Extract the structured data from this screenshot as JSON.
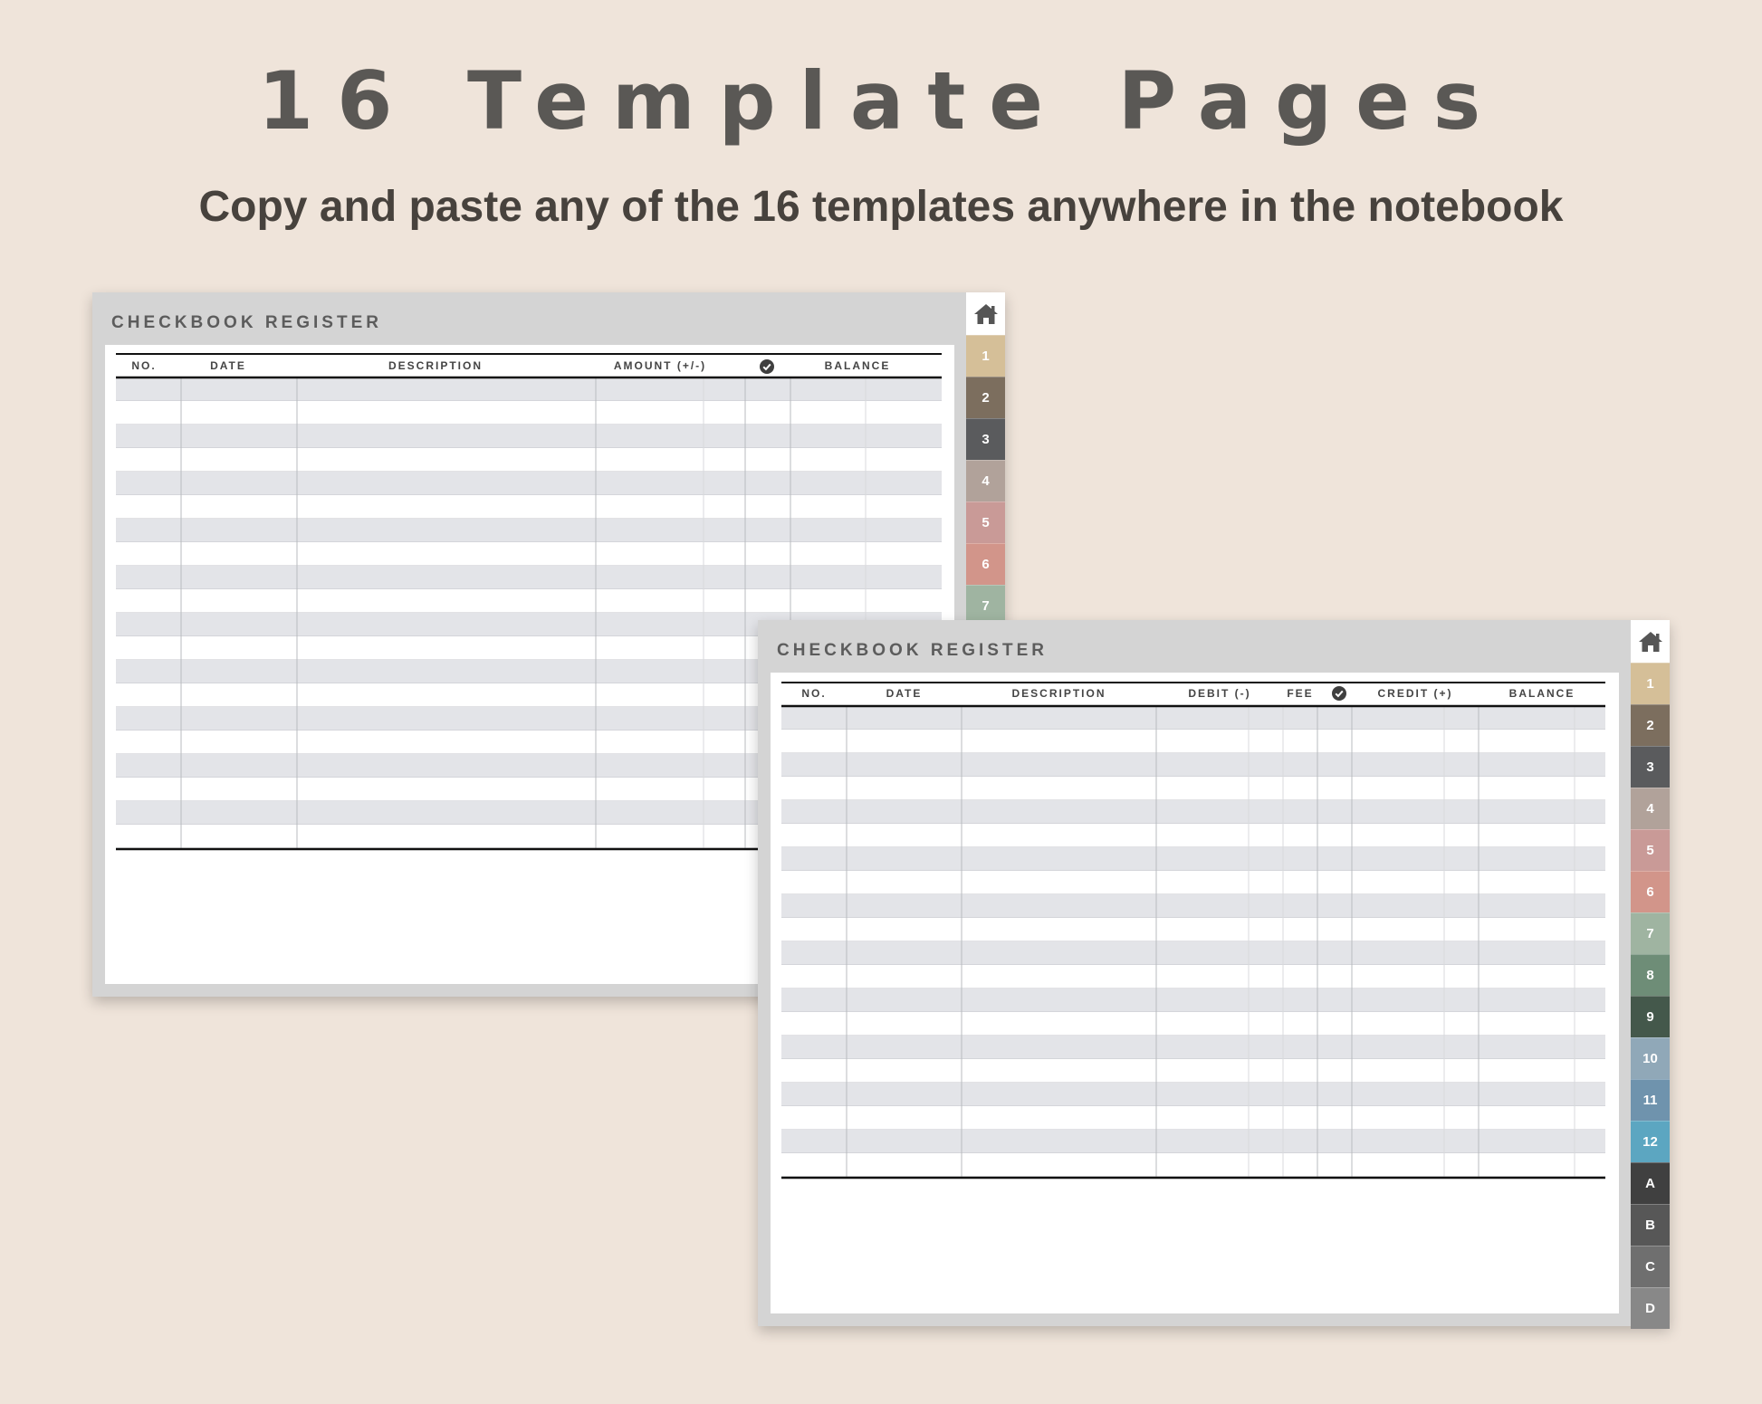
{
  "headline": "16 Template Pages",
  "subheadline": "Copy and paste any of the 16 templates anywhere in the notebook",
  "card1": {
    "title": "CHECKBOOK REGISTER",
    "headers": [
      "NO.",
      "DATE",
      "DESCRIPTION",
      "AMOUNT (+/-)",
      "BALANCE"
    ],
    "check_icon": "check-circle-icon",
    "home_icon": "home-icon",
    "tabs": [
      {
        "label": "1",
        "color": "#d5bf98"
      },
      {
        "label": "2",
        "color": "#7c6e5e"
      },
      {
        "label": "3",
        "color": "#5a5b5d"
      },
      {
        "label": "4",
        "color": "#b1a29a"
      },
      {
        "label": "5",
        "color": "#c99a97"
      },
      {
        "label": "6",
        "color": "#d2958a"
      },
      {
        "label": "7",
        "color": "#9fb4a1"
      }
    ]
  },
  "card2": {
    "title": "CHECKBOOK REGISTER",
    "headers": [
      "NO.",
      "DATE",
      "DESCRIPTION",
      "DEBIT (-)",
      "FEE",
      "CREDIT (+)",
      "BALANCE"
    ],
    "check_icon": "check-circle-icon",
    "home_icon": "home-icon",
    "tabs": [
      {
        "label": "1",
        "color": "#d5bf98"
      },
      {
        "label": "2",
        "color": "#7c6e5e"
      },
      {
        "label": "3",
        "color": "#5a5b5d"
      },
      {
        "label": "4",
        "color": "#b1a29a"
      },
      {
        "label": "5",
        "color": "#c99a97"
      },
      {
        "label": "6",
        "color": "#d2958a"
      },
      {
        "label": "7",
        "color": "#9fb4a1"
      },
      {
        "label": "8",
        "color": "#6e8d77"
      },
      {
        "label": "9",
        "color": "#44584b"
      },
      {
        "label": "10",
        "color": "#90a8b8"
      },
      {
        "label": "11",
        "color": "#6f93ad"
      },
      {
        "label": "12",
        "color": "#5ca6c1"
      },
      {
        "label": "A",
        "color": "#404040"
      },
      {
        "label": "B",
        "color": "#575757"
      },
      {
        "label": "C",
        "color": "#6f6f6f"
      },
      {
        "label": "D",
        "color": "#888888"
      }
    ]
  }
}
